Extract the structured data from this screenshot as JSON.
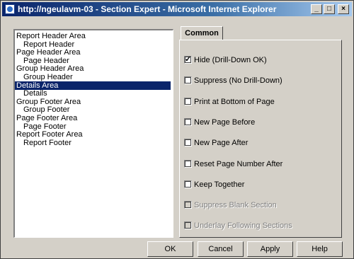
{
  "window": {
    "title": "http://ngeulavm-03 - Section Expert - Microsoft Internet Explorer",
    "controls": {
      "minimize": "_",
      "maximize": "□",
      "close": "×"
    }
  },
  "sections": [
    {
      "label": "Report Header Area",
      "level": 0,
      "selected": false
    },
    {
      "label": "Report Header",
      "level": 1,
      "selected": false
    },
    {
      "label": "Page Header Area",
      "level": 0,
      "selected": false
    },
    {
      "label": "Page Header",
      "level": 1,
      "selected": false
    },
    {
      "label": "Group Header Area",
      "level": 0,
      "selected": false
    },
    {
      "label": "Group Header",
      "level": 1,
      "selected": false
    },
    {
      "label": "Details Area",
      "level": 0,
      "selected": true
    },
    {
      "label": "Details",
      "level": 1,
      "selected": false
    },
    {
      "label": "Group Footer Area",
      "level": 0,
      "selected": false
    },
    {
      "label": "Group Footer",
      "level": 1,
      "selected": false
    },
    {
      "label": "Page Footer Area",
      "level": 0,
      "selected": false
    },
    {
      "label": "Page Footer",
      "level": 1,
      "selected": false
    },
    {
      "label": "Report Footer Area",
      "level": 0,
      "selected": false
    },
    {
      "label": "Report Footer",
      "level": 1,
      "selected": false
    }
  ],
  "tab": {
    "label": "Common"
  },
  "options": [
    {
      "label": "Hide (Drill-Down OK)",
      "checked": true,
      "enabled": true
    },
    {
      "label": "Suppress (No Drill-Down)",
      "checked": false,
      "enabled": true
    },
    {
      "label": "Print at Bottom of Page",
      "checked": false,
      "enabled": true
    },
    {
      "label": "New Page Before",
      "checked": false,
      "enabled": true
    },
    {
      "label": "New Page After",
      "checked": false,
      "enabled": true
    },
    {
      "label": "Reset Page Number After",
      "checked": false,
      "enabled": true
    },
    {
      "label": "Keep Together",
      "checked": false,
      "enabled": true
    },
    {
      "label": "Suppress Blank Section",
      "checked": false,
      "enabled": false
    },
    {
      "label": "Underlay Following Sections",
      "checked": false,
      "enabled": false
    }
  ],
  "buttons": {
    "ok": "OK",
    "cancel": "Cancel",
    "apply": "Apply",
    "help": "Help"
  },
  "colors": {
    "selection": "#0a246a",
    "titlebar_start": "#0a246a",
    "face": "#d4d0c8"
  }
}
